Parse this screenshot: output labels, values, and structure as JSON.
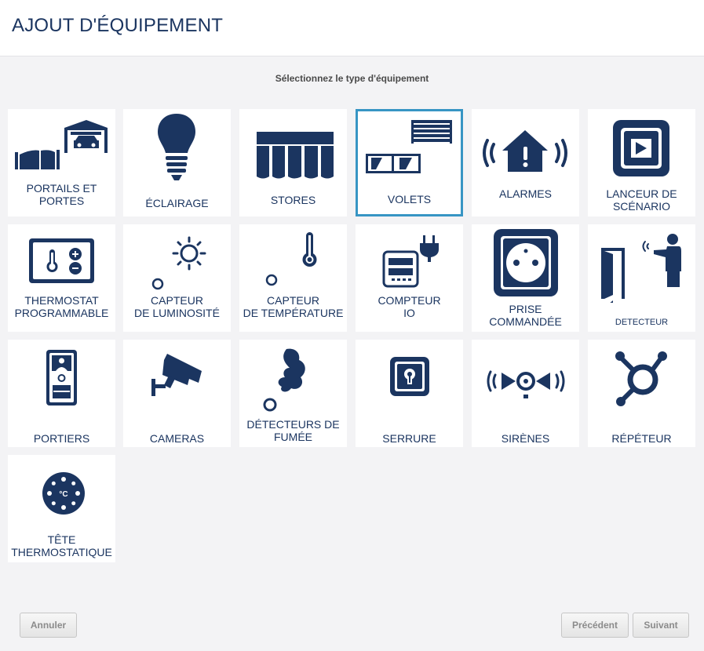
{
  "header": {
    "title": "AJOUT D'ÉQUIPEMENT"
  },
  "subtitle": "Sélectionnez le type d'équipement",
  "colors": {
    "accent": "#1b3560",
    "selected_border": "#3795c4"
  },
  "tiles": [
    {
      "label": "PORTAILS ET\nPORTES",
      "icon": "gate-garage-icon"
    },
    {
      "label": "ÉCLAIRAGE",
      "icon": "light-bulb-icon"
    },
    {
      "label": "STORES",
      "icon": "awning-icon"
    },
    {
      "label": "VOLETS",
      "icon": "shutter-icon",
      "selected": true
    },
    {
      "label": "ALARMES",
      "icon": "alarm-house-icon"
    },
    {
      "label": "LANCEUR DE\nSCÉNARIO",
      "icon": "play-scenario-icon"
    },
    {
      "label": "THERMOSTAT\nPROGRAMMABLE",
      "icon": "thermostat-icon"
    },
    {
      "label": "CAPTEUR\nDE LUMINOSITÉ",
      "icon": "sun-sensor-icon"
    },
    {
      "label": "CAPTEUR\nDE TEMPÉRATURE",
      "icon": "temperature-sensor-icon"
    },
    {
      "label": "COMPTEUR\nIO",
      "icon": "meter-plug-icon"
    },
    {
      "label": "PRISE\nCOMMANDÉE",
      "icon": "power-socket-icon"
    },
    {
      "label": "DETECTEUR",
      "icon": "door-detector-icon"
    },
    {
      "label": "PORTIERS",
      "icon": "intercom-icon"
    },
    {
      "label": "CAMERAS",
      "icon": "camera-icon"
    },
    {
      "label": "DÉTECTEURS DE\nFUMÉE",
      "icon": "smoke-detector-icon"
    },
    {
      "label": "SERRURE",
      "icon": "lock-icon"
    },
    {
      "label": "SIRÈNES",
      "icon": "siren-icon"
    },
    {
      "label": "RÉPÉTEUR",
      "icon": "repeater-icon"
    },
    {
      "label": "TÊTE\nTHERMOSTATIQUE",
      "icon": "thermostatic-head-icon"
    }
  ],
  "buttons": {
    "cancel": "Annuler",
    "previous": "Précédent",
    "next": "Suivant"
  }
}
